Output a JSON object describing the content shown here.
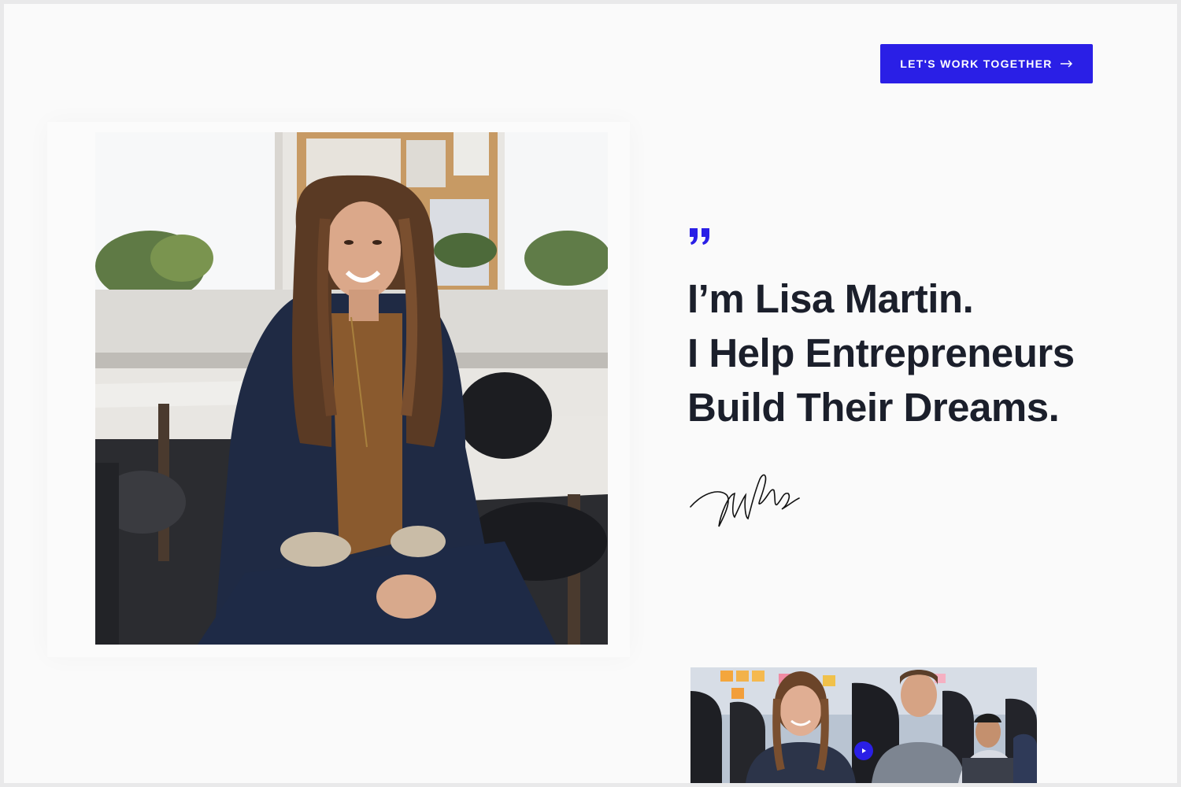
{
  "header": {
    "cta_label": "LET'S WORK TOGETHER",
    "cta_icon": "arrow-right-icon"
  },
  "hero": {
    "portrait_alt": "Lisa Martin seated in a bright office",
    "quote_icon": "quote-icon",
    "headline": [
      "I’m Lisa Martin.",
      "I Help Entrepreneurs",
      "Build Their Dreams."
    ],
    "signature_icon": "signature"
  },
  "video": {
    "play_icon": "play-icon"
  },
  "colors": {
    "accent": "#2a1fe6",
    "text": "#1b1f2b",
    "background": "#fafafa"
  }
}
